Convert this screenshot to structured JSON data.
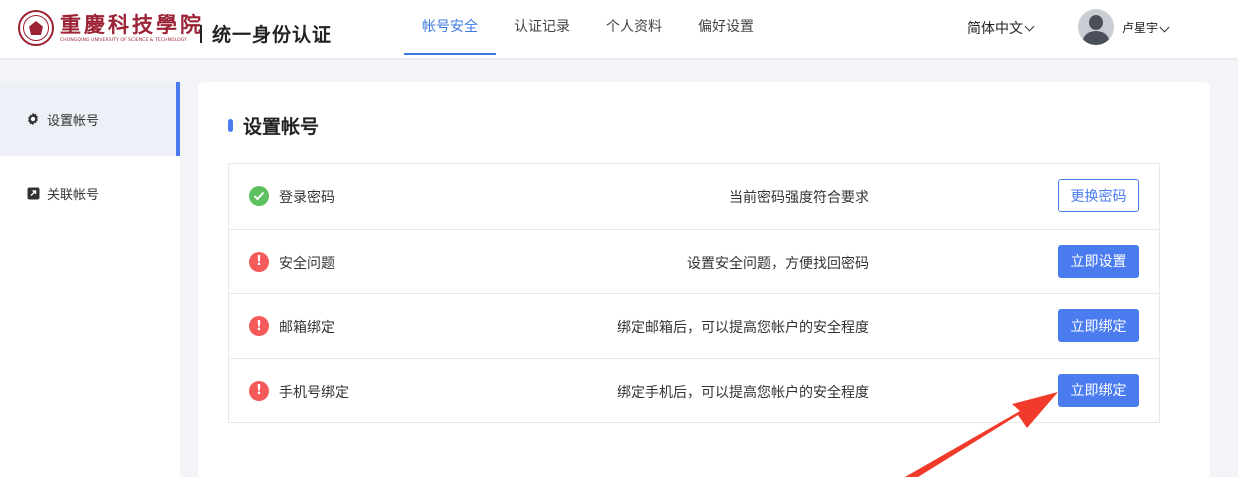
{
  "header": {
    "logo_cn": "重慶科技學院",
    "logo_en": "CHONGQING UNIVERSITY OF SCIENCE & TECHNOLOGY",
    "system_title": "统一身份认证",
    "nav": [
      "帐号安全",
      "认证记录",
      "个人资料",
      "偏好设置"
    ],
    "active_nav": "帐号安全",
    "language": "简体中文",
    "user_name": "卢星宇"
  },
  "sidebar": {
    "items": [
      {
        "label": "设置帐号",
        "icon": "gear-icon",
        "active": true
      },
      {
        "label": "关联帐号",
        "icon": "link-icon",
        "active": false
      }
    ]
  },
  "main": {
    "title": "设置帐号",
    "rows": [
      {
        "status": "ok",
        "label": "登录密码",
        "desc": "当前密码强度符合要求",
        "button": "更换密码",
        "button_style": "outline"
      },
      {
        "status": "warn",
        "label": "安全问题",
        "desc": "设置安全问题，方便找回密码",
        "button": "立即设置",
        "button_style": "primary"
      },
      {
        "status": "warn",
        "label": "邮箱绑定",
        "desc": "绑定邮箱后，可以提高您帐户的安全程度",
        "button": "立即绑定",
        "button_style": "primary"
      },
      {
        "status": "warn",
        "label": "手机号绑定",
        "desc": "绑定手机后，可以提高您帐户的安全程度",
        "button": "立即绑定",
        "button_style": "primary"
      }
    ]
  },
  "colors": {
    "accent": "#4a7cf0",
    "nav_active": "#3b7be0",
    "ok": "#5cc15e",
    "warn": "#f45a5a",
    "brand": "#9b2335",
    "annotation_arrow": "#f23a2a"
  }
}
